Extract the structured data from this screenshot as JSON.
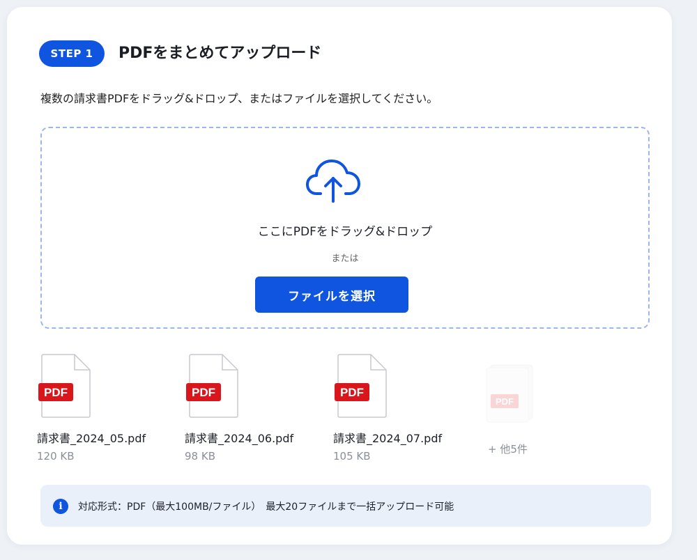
{
  "step": {
    "badge": "STEP 1",
    "title": "PDFをまとめてアップロード"
  },
  "instruction": "複数の請求書PDFをドラッグ&ドロップ、またはファイルを選択してください。",
  "dropzone": {
    "icon": "cloud-upload-icon",
    "main_text": "ここにPDFをドラッグ&ドロップ",
    "or_text": "または",
    "button_label": "ファイルを選択"
  },
  "files": [
    {
      "badge": "PDF",
      "name": "請求書_2024_05.pdf",
      "size": "120 KB"
    },
    {
      "badge": "PDF",
      "name": "請求書_2024_06.pdf",
      "size": "98 KB"
    },
    {
      "badge": "PDF",
      "name": "請求書_2024_07.pdf",
      "size": "105 KB"
    }
  ],
  "more": {
    "badge": "PDF",
    "label": "+ 他5件"
  },
  "info": {
    "icon": "info-icon",
    "text": "対応形式：PDF（最大100MB/ファイル）　最大20ファイルまで一括アップロード可能"
  },
  "colors": {
    "accent": "#0f55e0",
    "pdf_badge": "#d9161c",
    "dropzone_border": "#9bb6ea",
    "info_bg": "#eaf0f9"
  }
}
